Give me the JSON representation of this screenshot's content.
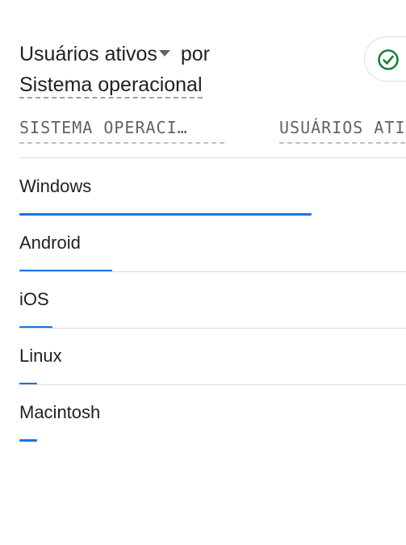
{
  "card": {
    "metric_label": "Usuários ativos",
    "connector": "por",
    "dimension_label": "Sistema operacional",
    "status_icon": "check-circle-icon",
    "status_color": "#188038",
    "accent_color": "#1a73e8"
  },
  "table": {
    "columns": [
      "SISTEMA OPERACI…",
      "USUÁRIOS ATIVOS"
    ],
    "rows": [
      {
        "label": "Windows",
        "share": 0.755
      },
      {
        "label": "Android",
        "share": 0.24
      },
      {
        "label": "iOS",
        "share": 0.085
      },
      {
        "label": "Linux",
        "share": 0.045
      },
      {
        "label": "Macintosh",
        "share": 0.045
      }
    ]
  }
}
